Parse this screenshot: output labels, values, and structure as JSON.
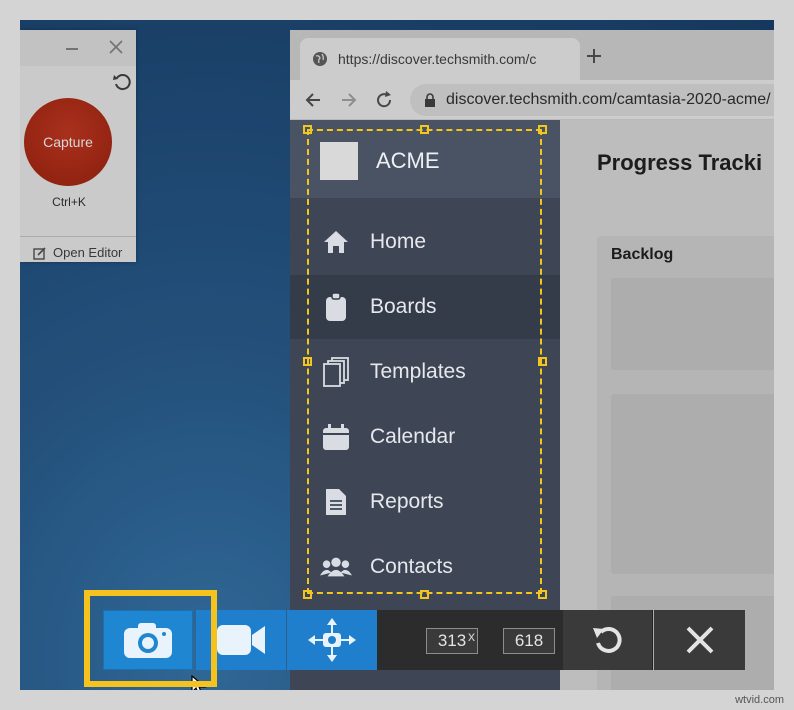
{
  "capture_widget": {
    "capture_label": "Capture",
    "hotkey": "Ctrl+K",
    "open_editor_label": "Open Editor"
  },
  "browser": {
    "tab_title": "https://discover.techsmith.com/c",
    "url": "discover.techsmith.com/camtasia-2020-acme/"
  },
  "app": {
    "brand": "ACME",
    "nav": [
      {
        "label": "Home",
        "icon": "home-icon"
      },
      {
        "label": "Boards",
        "icon": "clipboard-icon"
      },
      {
        "label": "Templates",
        "icon": "templates-icon"
      },
      {
        "label": "Calendar",
        "icon": "calendar-icon"
      },
      {
        "label": "Reports",
        "icon": "document-icon"
      },
      {
        "label": "Contacts",
        "icon": "contacts-icon"
      }
    ],
    "active_nav": "Boards",
    "page_title": "Progress Tracki",
    "column_title": "Backlog"
  },
  "capture_toolbar": {
    "width": "313",
    "height": "618",
    "separator": "x"
  },
  "watermark": "wtvid.com",
  "colors": {
    "selection": "#f3c61e",
    "capture_button": "#b02b16",
    "toolbar_blue": "#1f7fcc",
    "sidebar": "#3e4656"
  }
}
